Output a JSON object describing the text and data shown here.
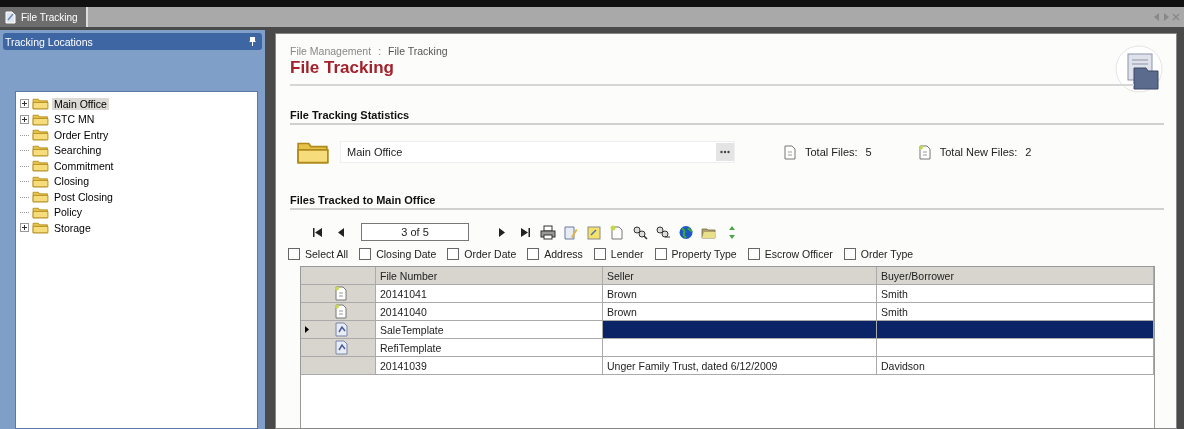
{
  "tab": {
    "title": "File Tracking",
    "selected": true
  },
  "sidebar": {
    "title": "Tracking Locations",
    "items": [
      {
        "label": "Main Office",
        "kind": "group",
        "expanded": false,
        "selected": true
      },
      {
        "label": "STC MN",
        "kind": "group",
        "expanded": false,
        "selected": false
      },
      {
        "label": "Order Entry",
        "kind": "leaf",
        "selected": false
      },
      {
        "label": "Searching",
        "kind": "leaf",
        "selected": false
      },
      {
        "label": "Commitment",
        "kind": "leaf",
        "selected": false
      },
      {
        "label": "Closing",
        "kind": "leaf",
        "selected": false
      },
      {
        "label": "Post Closing",
        "kind": "leaf",
        "selected": false
      },
      {
        "label": "Policy",
        "kind": "leaf",
        "selected": false
      },
      {
        "label": "Storage",
        "kind": "group",
        "expanded": false,
        "selected": false
      }
    ]
  },
  "main": {
    "breadcrumb": [
      "File Management",
      ":",
      "File Tracking"
    ],
    "title": "File Tracking",
    "statistics": {
      "heading": "File Tracking Statistics",
      "location": "Main Office",
      "total_files": {
        "label": "Total Files:",
        "value": "5"
      },
      "total_new_files": {
        "label": "Total New Files:",
        "value": "2"
      }
    },
    "files": {
      "heading": "Files Tracked to Main Office",
      "pager": "3 of 5",
      "filters": [
        {
          "label": "Select All",
          "checked": false
        },
        {
          "label": "Closing Date",
          "checked": false
        },
        {
          "label": "Order Date",
          "checked": false
        },
        {
          "label": "Address",
          "checked": false
        },
        {
          "label": "Lender",
          "checked": false
        },
        {
          "label": "Property Type",
          "checked": false
        },
        {
          "label": "Escrow Officer",
          "checked": false
        },
        {
          "label": "Order Type",
          "checked": false
        }
      ],
      "table": {
        "columns": [
          "File Number",
          "Seller",
          "Buyer/Borrower"
        ],
        "rows": [
          {
            "kind": "new-file",
            "selected": false,
            "cells": [
              "20141041",
              "Brown",
              "Smith"
            ]
          },
          {
            "kind": "new-file",
            "selected": false,
            "cells": [
              "20141040",
              "Brown",
              "Smith"
            ]
          },
          {
            "kind": "template",
            "selected": true,
            "cells": [
              "SaleTemplate",
              "",
              ""
            ]
          },
          {
            "kind": "template",
            "selected": false,
            "cells": [
              "RefiTemplate",
              "",
              ""
            ]
          },
          {
            "kind": "plain",
            "selected": false,
            "cells": [
              "20141039",
              "Unger Family Trust, dated 6/12/2009",
              "Davidson"
            ]
          }
        ]
      }
    }
  }
}
